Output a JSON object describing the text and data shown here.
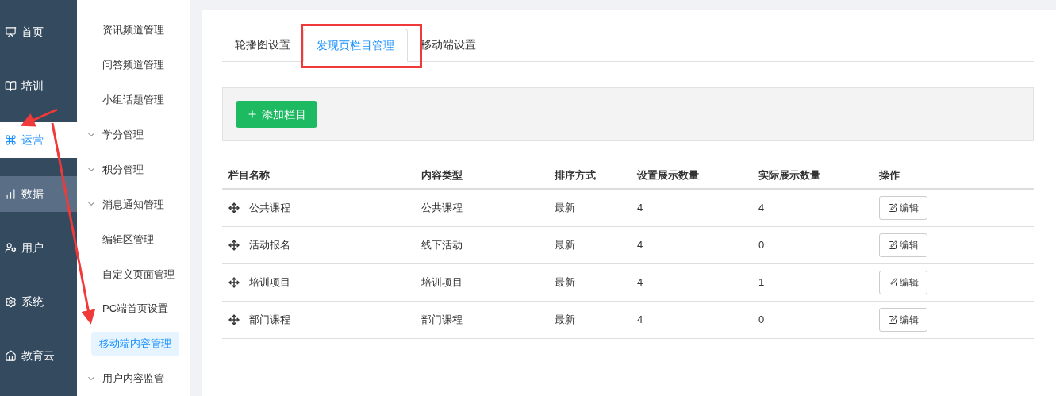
{
  "sidebar": {
    "items": [
      {
        "label": "首页",
        "selected": false,
        "hovered": false
      },
      {
        "label": "培训",
        "selected": false,
        "hovered": false
      },
      {
        "label": "运营",
        "selected": true,
        "hovered": false
      },
      {
        "label": "数据",
        "selected": false,
        "hovered": true
      },
      {
        "label": "用户",
        "selected": false,
        "hovered": false
      },
      {
        "label": "系统",
        "selected": false,
        "hovered": false
      },
      {
        "label": "教育云",
        "selected": false,
        "hovered": false
      }
    ]
  },
  "submenu": {
    "items": [
      {
        "label": "资讯频道管理",
        "kind": "link",
        "selected": false
      },
      {
        "label": "问答频道管理",
        "kind": "link",
        "selected": false
      },
      {
        "label": "小组话题管理",
        "kind": "link",
        "selected": false
      },
      {
        "label": "学分管理",
        "kind": "group",
        "selected": false
      },
      {
        "label": "积分管理",
        "kind": "group",
        "selected": false
      },
      {
        "label": "消息通知管理",
        "kind": "group",
        "selected": false
      },
      {
        "label": "编辑区管理",
        "kind": "link",
        "selected": false
      },
      {
        "label": "自定义页面管理",
        "kind": "link",
        "selected": false
      },
      {
        "label": "PC端首页设置",
        "kind": "link",
        "selected": false
      },
      {
        "label": "移动端内容管理",
        "kind": "link",
        "selected": true
      },
      {
        "label": "用户内容监管",
        "kind": "group",
        "selected": false
      }
    ]
  },
  "tabs": [
    {
      "label": "轮播图设置",
      "selected": false
    },
    {
      "label": "发现页栏目管理",
      "selected": true
    },
    {
      "label": "移动端设置",
      "selected": false
    }
  ],
  "add_button": {
    "label": "添加栏目"
  },
  "table": {
    "columns": [
      "栏目名称",
      "内容类型",
      "排序方式",
      "设置展示数量",
      "实际展示数量",
      "操作"
    ],
    "rows": [
      {
        "name": "公共课程",
        "type": "公共课程",
        "sort": "最新",
        "set_count": "4",
        "actual_count": "4",
        "action": "编辑"
      },
      {
        "name": "活动报名",
        "type": "线下活动",
        "sort": "最新",
        "set_count": "4",
        "actual_count": "0",
        "action": "编辑"
      },
      {
        "name": "培训项目",
        "type": "培训项目",
        "sort": "最新",
        "set_count": "4",
        "actual_count": "1",
        "action": "编辑"
      },
      {
        "name": "部门课程",
        "type": "部门课程",
        "sort": "最新",
        "set_count": "4",
        "actual_count": "0",
        "action": "编辑"
      }
    ]
  }
}
